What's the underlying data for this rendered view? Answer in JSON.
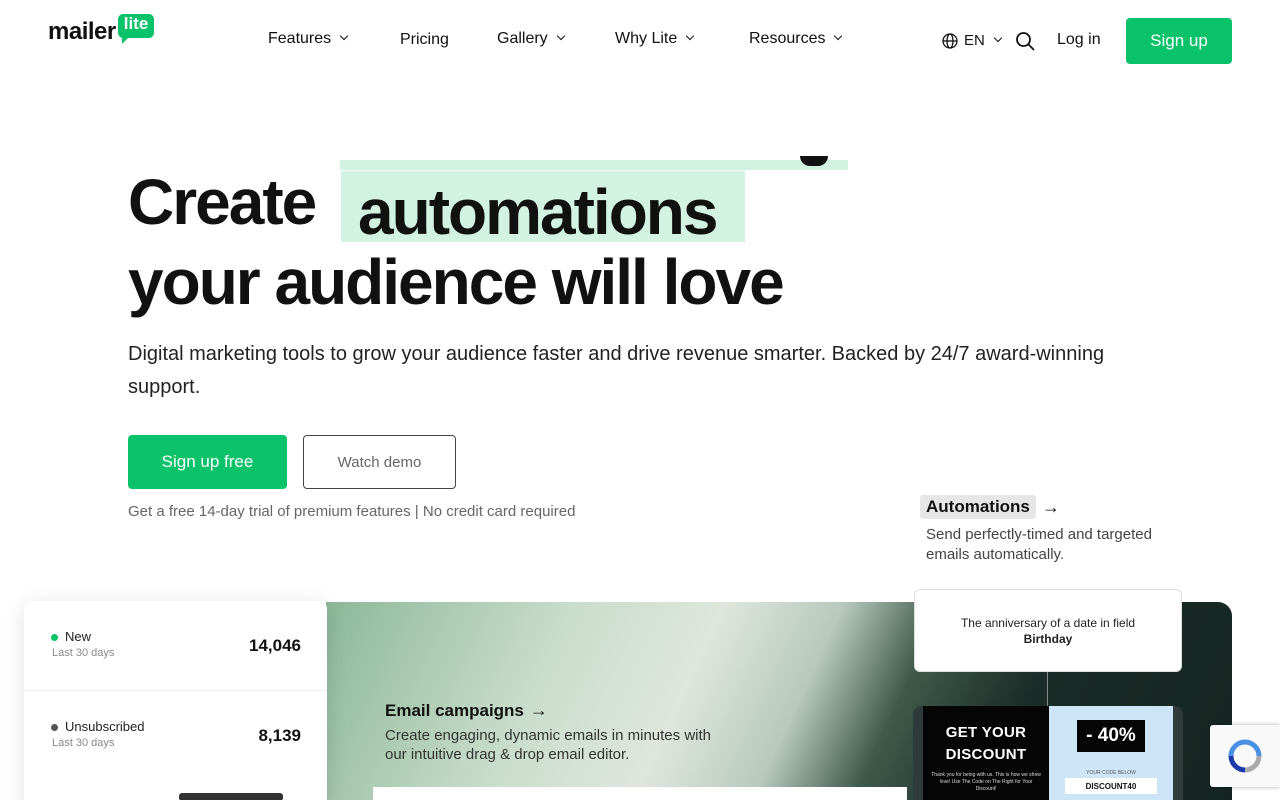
{
  "logo": {
    "word": "mailer",
    "badge": "lite"
  },
  "nav": {
    "items": [
      {
        "label": "Features",
        "has_dropdown": true
      },
      {
        "label": "Pricing",
        "has_dropdown": false
      },
      {
        "label": "Gallery",
        "has_dropdown": true
      },
      {
        "label": "Why Lite",
        "has_dropdown": true
      },
      {
        "label": "Resources",
        "has_dropdown": true
      }
    ],
    "language": "EN",
    "login": "Log in",
    "signup": "Sign up"
  },
  "hero": {
    "word_create": "Create",
    "highlight_word": "automations",
    "line2": "your audience will love",
    "subtitle": "Digital marketing tools to grow your audience faster and drive revenue smarter. Backed by 24/7 award-winning support.",
    "primary_cta": "Sign up free",
    "secondary_cta": "Watch demo",
    "trial_note": "Get a free 14-day trial of premium features | No credit card required"
  },
  "automations_callout": {
    "title": "Automations",
    "arrow": "→",
    "description": "Send perfectly-timed and targeted emails automatically."
  },
  "stats": [
    {
      "label": "New",
      "sub": "Last 30 days",
      "value": "14,046",
      "dot_color": "#09c269"
    },
    {
      "label": "Unsubscribed",
      "sub": "Last 30 days",
      "value": "8,139",
      "dot_color": "#555555"
    }
  ],
  "campaigns": {
    "title": "Email campaigns",
    "arrow": "→",
    "description": "Create engaging, dynamic emails in minutes with our intuitive drag & drop email editor."
  },
  "trigger_card": {
    "text": "The anniversary of a date in field",
    "field": "Birthday"
  },
  "email_preview": {
    "headline_1": "GET YOUR",
    "headline_2": "DISCOUNT",
    "body": "Thank you for being with us. This is how we show love! Use The Code on The Right for Your Discount!",
    "badge": "- 40%",
    "code_label": "YOUR CODE BELOW",
    "code": "DISCOUNT40"
  },
  "colors": {
    "brand": "#09c269",
    "highlight": "#d3f3e2"
  }
}
